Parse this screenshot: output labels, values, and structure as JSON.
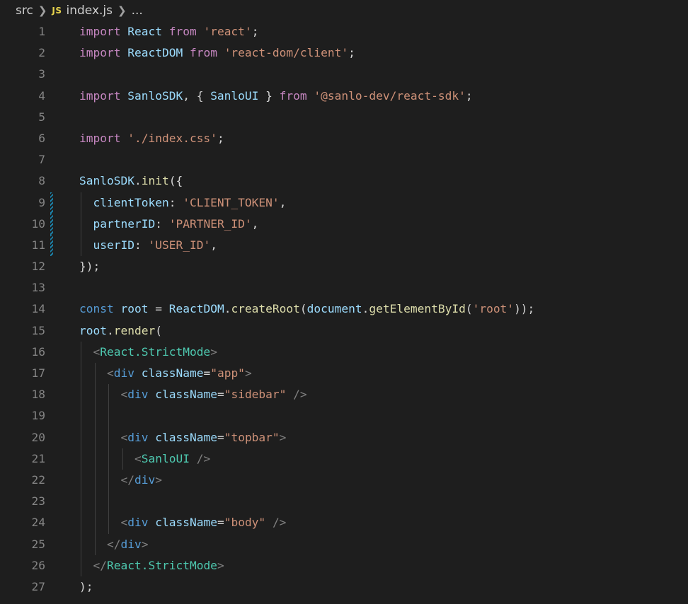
{
  "breadcrumb": {
    "folder": "src",
    "file_icon": "JS",
    "file": "index.js",
    "more": "..."
  },
  "colors": {
    "background": "#1e1e1e",
    "line_number": "#858585",
    "keyword": "#c586c0",
    "storage": "#569cd6",
    "variable": "#9cdcfe",
    "type": "#4ec9b0",
    "function": "#dcdcaa",
    "string": "#ce9178",
    "modified_gutter": "#1b81a8"
  },
  "lines": [
    {
      "n": "1",
      "mod": false,
      "guides": [],
      "tokens": [
        [
          "kw",
          "import"
        ],
        [
          "pun",
          " "
        ],
        [
          "id",
          "React"
        ],
        [
          "pun",
          " "
        ],
        [
          "kw",
          "from"
        ],
        [
          "pun",
          " "
        ],
        [
          "str",
          "'react'"
        ],
        [
          "pun",
          ";"
        ]
      ]
    },
    {
      "n": "2",
      "mod": false,
      "guides": [],
      "tokens": [
        [
          "kw",
          "import"
        ],
        [
          "pun",
          " "
        ],
        [
          "id",
          "ReactDOM"
        ],
        [
          "pun",
          " "
        ],
        [
          "kw",
          "from"
        ],
        [
          "pun",
          " "
        ],
        [
          "str",
          "'react-dom/client'"
        ],
        [
          "pun",
          ";"
        ]
      ]
    },
    {
      "n": "3",
      "mod": false,
      "guides": [],
      "tokens": []
    },
    {
      "n": "4",
      "mod": false,
      "guides": [],
      "tokens": [
        [
          "kw",
          "import"
        ],
        [
          "pun",
          " "
        ],
        [
          "id",
          "SanloSDK"
        ],
        [
          "pun",
          ", { "
        ],
        [
          "id",
          "SanloUI"
        ],
        [
          "pun",
          " } "
        ],
        [
          "kw",
          "from"
        ],
        [
          "pun",
          " "
        ],
        [
          "str",
          "'@sanlo-dev/react-sdk'"
        ],
        [
          "pun",
          ";"
        ]
      ]
    },
    {
      "n": "5",
      "mod": false,
      "guides": [],
      "tokens": []
    },
    {
      "n": "6",
      "mod": false,
      "guides": [],
      "tokens": [
        [
          "kw",
          "import"
        ],
        [
          "pun",
          " "
        ],
        [
          "str",
          "'./index.css'"
        ],
        [
          "pun",
          ";"
        ]
      ]
    },
    {
      "n": "7",
      "mod": false,
      "guides": [],
      "tokens": []
    },
    {
      "n": "8",
      "mod": false,
      "guides": [],
      "tokens": [
        [
          "id",
          "SanloSDK"
        ],
        [
          "pun",
          "."
        ],
        [
          "fn",
          "init"
        ],
        [
          "pun",
          "({"
        ]
      ]
    },
    {
      "n": "9",
      "mod": true,
      "guides": [
        1
      ],
      "tokens": [
        [
          "pun",
          "  "
        ],
        [
          "id",
          "clientToken"
        ],
        [
          "pun",
          ": "
        ],
        [
          "str",
          "'CLIENT_TOKEN'"
        ],
        [
          "pun",
          ","
        ]
      ]
    },
    {
      "n": "10",
      "mod": true,
      "guides": [
        1
      ],
      "tokens": [
        [
          "pun",
          "  "
        ],
        [
          "id",
          "partnerID"
        ],
        [
          "pun",
          ": "
        ],
        [
          "str",
          "'PARTNER_ID'"
        ],
        [
          "pun",
          ","
        ]
      ]
    },
    {
      "n": "11",
      "mod": true,
      "guides": [
        1
      ],
      "tokens": [
        [
          "pun",
          "  "
        ],
        [
          "id",
          "userID"
        ],
        [
          "pun",
          ": "
        ],
        [
          "str",
          "'USER_ID'"
        ],
        [
          "pun",
          ","
        ]
      ]
    },
    {
      "n": "12",
      "mod": false,
      "guides": [],
      "tokens": [
        [
          "pun",
          "});"
        ]
      ]
    },
    {
      "n": "13",
      "mod": false,
      "guides": [],
      "tokens": []
    },
    {
      "n": "14",
      "mod": false,
      "guides": [],
      "tokens": [
        [
          "kwb",
          "const"
        ],
        [
          "pun",
          " "
        ],
        [
          "id",
          "root"
        ],
        [
          "pun",
          " = "
        ],
        [
          "id",
          "ReactDOM"
        ],
        [
          "pun",
          "."
        ],
        [
          "fn",
          "createRoot"
        ],
        [
          "pun",
          "("
        ],
        [
          "id",
          "document"
        ],
        [
          "pun",
          "."
        ],
        [
          "fn",
          "getElementById"
        ],
        [
          "pun",
          "("
        ],
        [
          "str",
          "'root'"
        ],
        [
          "pun",
          "));"
        ]
      ]
    },
    {
      "n": "15",
      "mod": false,
      "guides": [],
      "tokens": [
        [
          "id",
          "root"
        ],
        [
          "pun",
          "."
        ],
        [
          "fn",
          "render"
        ],
        [
          "pun",
          "("
        ]
      ]
    },
    {
      "n": "16",
      "mod": false,
      "guides": [
        1
      ],
      "tokens": [
        [
          "pun",
          "  "
        ],
        [
          "tagp",
          "<"
        ],
        [
          "cls",
          "React.StrictMode"
        ],
        [
          "tagp",
          ">"
        ]
      ]
    },
    {
      "n": "17",
      "mod": false,
      "guides": [
        1,
        2
      ],
      "tokens": [
        [
          "pun",
          "    "
        ],
        [
          "tagp",
          "<"
        ],
        [
          "kwb",
          "div"
        ],
        [
          "pun",
          " "
        ],
        [
          "attr",
          "className"
        ],
        [
          "pun",
          "="
        ],
        [
          "str",
          "\"app\""
        ],
        [
          "tagp",
          ">"
        ]
      ]
    },
    {
      "n": "18",
      "mod": false,
      "guides": [
        1,
        2,
        3
      ],
      "tokens": [
        [
          "pun",
          "      "
        ],
        [
          "tagp",
          "<"
        ],
        [
          "kwb",
          "div"
        ],
        [
          "pun",
          " "
        ],
        [
          "attr",
          "className"
        ],
        [
          "pun",
          "="
        ],
        [
          "str",
          "\"sidebar\""
        ],
        [
          "pun",
          " "
        ],
        [
          "tagp",
          "/>"
        ]
      ]
    },
    {
      "n": "19",
      "mod": false,
      "guides": [
        1,
        2,
        3
      ],
      "tokens": []
    },
    {
      "n": "20",
      "mod": false,
      "guides": [
        1,
        2,
        3
      ],
      "tokens": [
        [
          "pun",
          "      "
        ],
        [
          "tagp",
          "<"
        ],
        [
          "kwb",
          "div"
        ],
        [
          "pun",
          " "
        ],
        [
          "attr",
          "className"
        ],
        [
          "pun",
          "="
        ],
        [
          "str",
          "\"topbar\""
        ],
        [
          "tagp",
          ">"
        ]
      ]
    },
    {
      "n": "21",
      "mod": false,
      "guides": [
        1,
        2,
        3,
        4
      ],
      "tokens": [
        [
          "pun",
          "        "
        ],
        [
          "tagp",
          "<"
        ],
        [
          "cls",
          "SanloUI"
        ],
        [
          "pun",
          " "
        ],
        [
          "tagp",
          "/>"
        ]
      ]
    },
    {
      "n": "22",
      "mod": false,
      "guides": [
        1,
        2,
        3
      ],
      "tokens": [
        [
          "pun",
          "      "
        ],
        [
          "tagp",
          "</"
        ],
        [
          "kwb",
          "div"
        ],
        [
          "tagp",
          ">"
        ]
      ]
    },
    {
      "n": "23",
      "mod": false,
      "guides": [
        1,
        2,
        3
      ],
      "tokens": []
    },
    {
      "n": "24",
      "mod": false,
      "guides": [
        1,
        2,
        3
      ],
      "tokens": [
        [
          "pun",
          "      "
        ],
        [
          "tagp",
          "<"
        ],
        [
          "kwb",
          "div"
        ],
        [
          "pun",
          " "
        ],
        [
          "attr",
          "className"
        ],
        [
          "pun",
          "="
        ],
        [
          "str",
          "\"body\""
        ],
        [
          "pun",
          " "
        ],
        [
          "tagp",
          "/>"
        ]
      ]
    },
    {
      "n": "25",
      "mod": false,
      "guides": [
        1,
        2
      ],
      "tokens": [
        [
          "pun",
          "    "
        ],
        [
          "tagp",
          "</"
        ],
        [
          "kwb",
          "div"
        ],
        [
          "tagp",
          ">"
        ]
      ]
    },
    {
      "n": "26",
      "mod": false,
      "guides": [
        1
      ],
      "tokens": [
        [
          "pun",
          "  "
        ],
        [
          "tagp",
          "</"
        ],
        [
          "cls",
          "React.StrictMode"
        ],
        [
          "tagp",
          ">"
        ]
      ]
    },
    {
      "n": "27",
      "mod": false,
      "guides": [],
      "tokens": [
        [
          "pun",
          ");"
        ]
      ]
    }
  ]
}
